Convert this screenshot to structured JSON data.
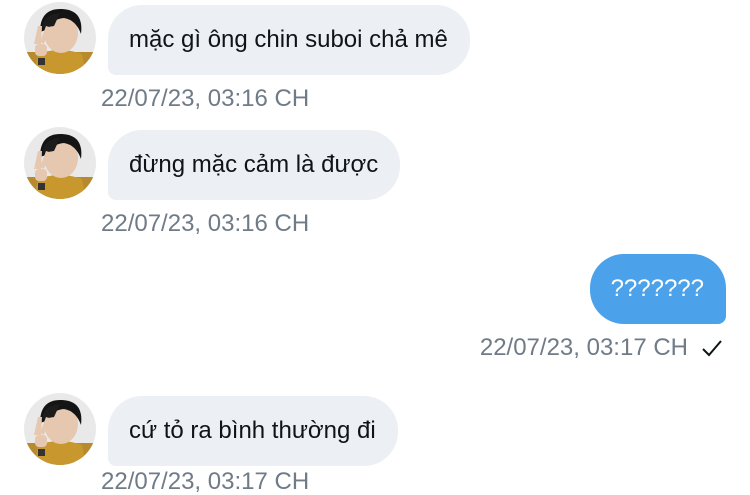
{
  "messages": [
    {
      "direction": "incoming",
      "text": "mặc gì ông chin suboi chả mê",
      "timestamp": "22/07/23, 03:16 CH"
    },
    {
      "direction": "incoming",
      "text": "đừng mặc cảm là được",
      "timestamp": "22/07/23, 03:16 CH"
    },
    {
      "direction": "outgoing",
      "text": "???????",
      "timestamp": "22/07/23, 03:17 CH",
      "status_icon": "checkmark-icon"
    },
    {
      "direction": "incoming",
      "text": "cứ tỏ ra bình thường đi",
      "timestamp": "22/07/23, 03:17 CH"
    }
  ],
  "colors": {
    "incoming_bubble": "#eceff3",
    "outgoing_bubble": "#4ba2ea",
    "timestamp": "#6f7b87"
  }
}
